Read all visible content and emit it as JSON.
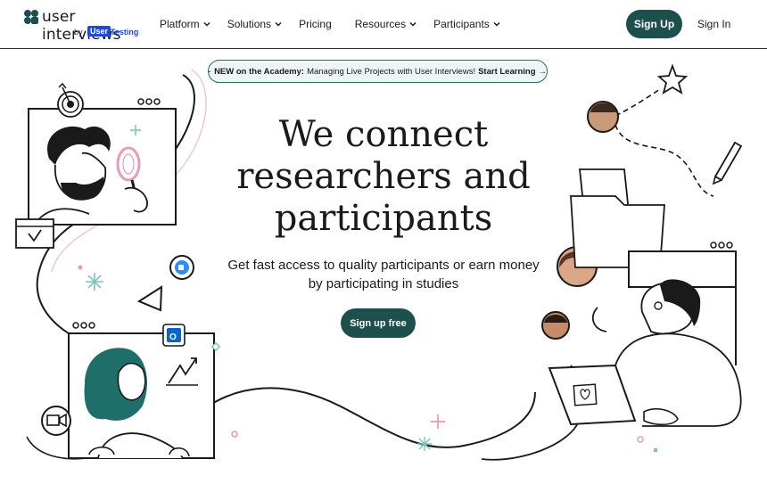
{
  "brand": {
    "name": "user interviews",
    "by": "by",
    "partner_part1": "User",
    "partner_part2": "Testing"
  },
  "nav": {
    "items": [
      {
        "label": "Platform",
        "has_dropdown": true
      },
      {
        "label": "Solutions",
        "has_dropdown": true
      },
      {
        "label": "Pricing",
        "has_dropdown": false
      },
      {
        "label": "Resources",
        "has_dropdown": true
      },
      {
        "label": "Participants",
        "has_dropdown": true
      }
    ],
    "signup_label": "Sign Up",
    "signin_label": "Sign In"
  },
  "banner": {
    "prefix": "NEW on the Academy:",
    "text": "Managing Live Projects with User Interviews!",
    "cta": "Start Learning",
    "arrow": "→",
    "icon": "graduation-cap-icon"
  },
  "hero": {
    "title_lines": [
      "We connect",
      "researchers and",
      "participants"
    ],
    "subtitle": "Get fast access to quality participants or earn money by participating in studies",
    "cta_label": "Sign up free"
  },
  "colors": {
    "primary": "#1d4f4d",
    "accent_teal": "#2d6a66",
    "accent_pink": "#e89bb6",
    "partner_blue": "#1f4ad6"
  }
}
